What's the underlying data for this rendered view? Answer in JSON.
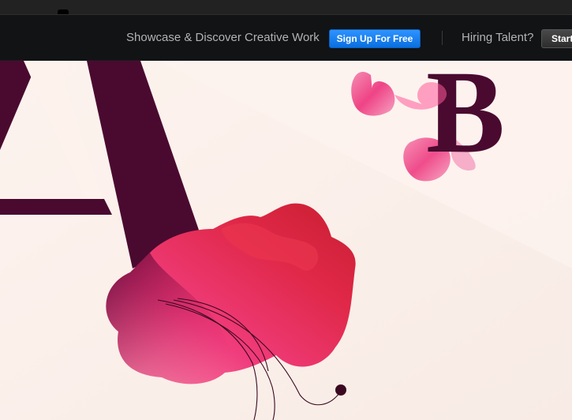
{
  "navbar": {
    "tagline": "Showcase & Discover Creative Work",
    "signup_label": "Sign Up For Free",
    "hiring_text": "Hiring Talent?",
    "start_label": "Start"
  },
  "artwork": {
    "letter_a": "A",
    "letter_b": "B"
  },
  "colors": {
    "background": "#fdf2ec",
    "navbar": "#111315",
    "signup_button": "#1a84f5",
    "letter": "#4a0a30",
    "flower_pink": "#f0407a",
    "flower_red": "#d0203a"
  }
}
